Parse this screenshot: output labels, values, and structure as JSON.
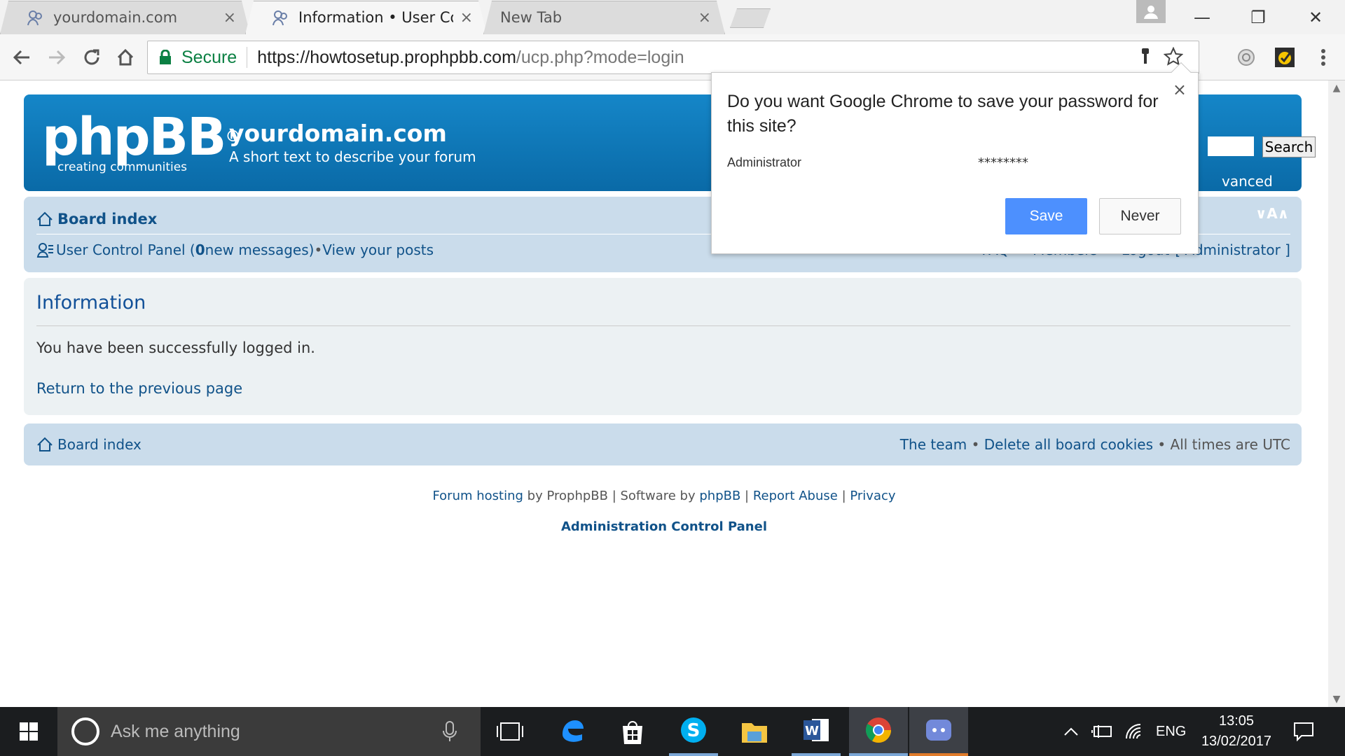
{
  "browser": {
    "tabs": [
      {
        "title": "yourdomain.com",
        "close": "×"
      },
      {
        "title": "Information • User Contr",
        "close": "×"
      },
      {
        "title": "New Tab",
        "close": "×"
      }
    ],
    "window": {
      "minimize": "—",
      "restore": "❐",
      "close": "✕"
    },
    "omnibox": {
      "secure_label": "Secure",
      "url_scheme": "https://",
      "url_host": "howtosetup.prophpbb.com",
      "url_path": "/ucp.php?mode=login"
    }
  },
  "forum": {
    "logo_text": "phpBB",
    "logo_reg": "®",
    "logo_sub": "creating communities",
    "site_name": "yourdomain.com",
    "site_desc": "A short text to describe your forum",
    "search_button": "Search",
    "advanced_search": "vanced search",
    "font_ctl": "∨A∧",
    "navbar": {
      "board_index": "Board index",
      "ucp_label": "User Control Panel (",
      "new_count": "0",
      "new_messages": " new messages)",
      "bullet": " • ",
      "view_posts": "View your posts",
      "faq": "FAQ",
      "members": "Members",
      "logout": "Logout",
      "user": "[ Administrator ]"
    },
    "panel": {
      "heading": "Information",
      "message": "You have been successfully logged in.",
      "return_link": "Return to the previous page"
    },
    "footer_nav": {
      "board_index": "Board index",
      "team": "The team",
      "bullet": " • ",
      "delete_cookies": "Delete all board cookies",
      "times": "All times are UTC"
    },
    "copyright": {
      "forum_hosting": "Forum hosting",
      "by1": " by ProphpBB | Software by ",
      "phpbb": "phpBB",
      "sep1": " | ",
      "report": "Report Abuse",
      "sep2": " | ",
      "privacy": "Privacy",
      "acp": "Administration Control Panel"
    }
  },
  "password_bubble": {
    "question": "Do you want Google Chrome to save your password for this site?",
    "username": "Administrator",
    "password": "********",
    "save": "Save",
    "never": "Never",
    "close": "×"
  },
  "taskbar": {
    "search_placeholder": "Ask me anything",
    "language": "ENG",
    "time": "13:05",
    "date": "13/02/2017"
  },
  "colors": {
    "header_blue": "#0a6aa7",
    "nav_bg": "#cadceb",
    "link": "#105289",
    "save_blue": "#4d90fe",
    "secure_green": "#0b8043"
  }
}
